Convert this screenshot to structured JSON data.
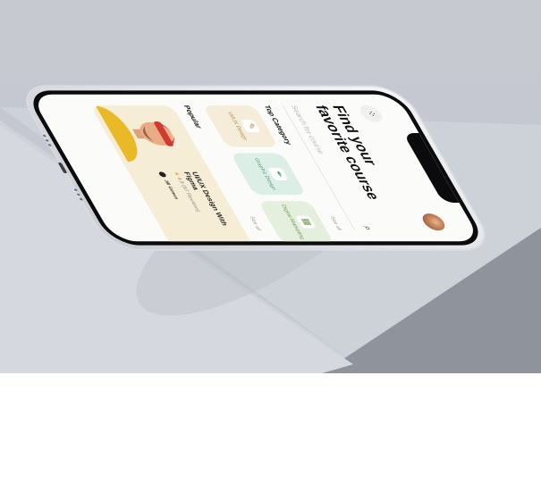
{
  "app": {
    "title": "Find your favorite course",
    "search": {
      "placeholder": "Search for course"
    },
    "sections": {
      "categories": {
        "label": "Top Category",
        "see_all": "See all"
      },
      "popular": {
        "label": "Popular",
        "see_all": "See all"
      }
    },
    "categories": [
      {
        "label": "UI/UX Design",
        "icon": "palette-icon"
      },
      {
        "label": "Graphic Design",
        "icon": "pen-icon"
      },
      {
        "label": "Digital Marketing",
        "icon": "chart-icon"
      }
    ],
    "popular_card": {
      "title": "UI/UX Design With Figma",
      "rating": "4.9",
      "reviews": "(87 Reviews)",
      "author": "Jill Gomes"
    }
  },
  "colors": {
    "scene": "#c6c9d0",
    "accent_yellow": "#f6edd6",
    "accent_green": "#dcefe6"
  }
}
